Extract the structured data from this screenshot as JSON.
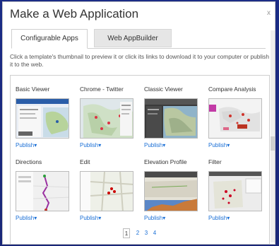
{
  "dialog": {
    "title": "Make a Web Application",
    "close_glyph": "x"
  },
  "tabs": [
    {
      "label": "Configurable Apps",
      "active": true
    },
    {
      "label": "Web AppBuilder",
      "active": false
    }
  ],
  "instruction": "Click a template's thumbnail to preview it or click its links to download it to your computer or publish it to the web.",
  "templates": [
    {
      "name": "Basic Viewer",
      "action": "Publish▾",
      "thumb_icon": "basic-viewer-map-thumbnail"
    },
    {
      "name": "Chrome - Twitter",
      "action": "Publish▾",
      "thumb_icon": "chrome-twitter-map-thumbnail"
    },
    {
      "name": "Classic Viewer",
      "action": "Publish▾",
      "thumb_icon": "classic-viewer-map-thumbnail"
    },
    {
      "name": "Compare Analysis",
      "action": "Publish▾",
      "thumb_icon": "compare-analysis-map-thumbnail"
    },
    {
      "name": "Directions",
      "action": "Publish▾",
      "thumb_icon": "directions-map-thumbnail"
    },
    {
      "name": "Edit",
      "action": "Publish▾",
      "thumb_icon": "edit-map-thumbnail"
    },
    {
      "name": "Elevation Profile",
      "action": "Publish▾",
      "thumb_icon": "elevation-profile-map-thumbnail"
    },
    {
      "name": "Filter",
      "action": "Publish▾",
      "thumb_icon": "filter-map-thumbnail"
    }
  ],
  "pagination": {
    "pages": [
      "1",
      "2",
      "3",
      "4"
    ],
    "current": "1"
  },
  "colors": {
    "backdrop": "#1a2a7a",
    "link": "#1a6fd6",
    "tab_inactive": "#e6e6e6"
  }
}
